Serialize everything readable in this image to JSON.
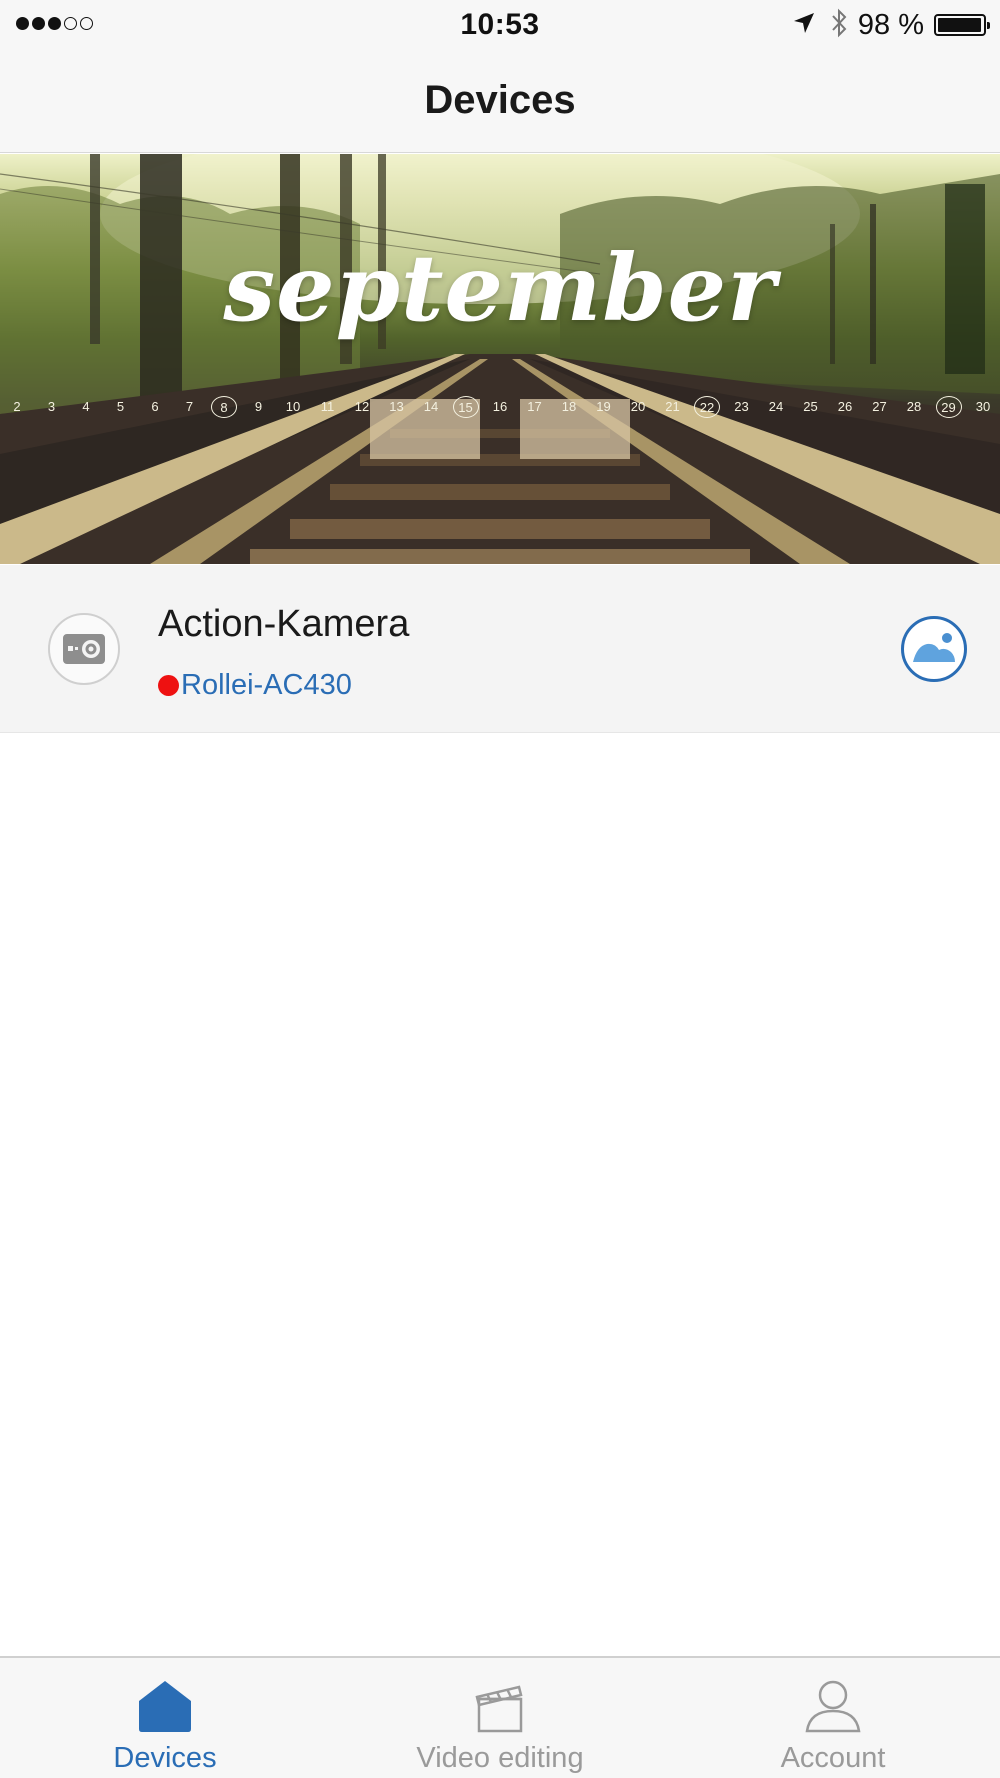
{
  "status_bar": {
    "signal_full_dots": 3,
    "signal_empty_dots": 2,
    "time": "10:53",
    "battery_percent_label": "98 %",
    "battery_level": 0.98,
    "icons": [
      "location-arrow-icon",
      "bluetooth-icon",
      "battery-icon"
    ]
  },
  "nav": {
    "title": "Devices"
  },
  "banner": {
    "word": "september",
    "days": [
      "2",
      "3",
      "4",
      "5",
      "6",
      "7",
      "8",
      "9",
      "10",
      "11",
      "12",
      "13",
      "14",
      "15",
      "16",
      "17",
      "18",
      "19",
      "20",
      "21",
      "22",
      "23",
      "24",
      "25",
      "26",
      "27",
      "28",
      "29",
      "30"
    ],
    "circled_days": [
      "8",
      "15",
      "22",
      "29"
    ]
  },
  "device": {
    "name": "Action-Kamera",
    "model": "Rollei-AC430",
    "status_color": "#ee1111",
    "icon": "camera-icon",
    "action_icon": "gallery-icon"
  },
  "tabs": [
    {
      "label": "Devices",
      "icon": "home-icon",
      "active": true
    },
    {
      "label": "Video editing",
      "icon": "clapperboard-icon",
      "active": false
    },
    {
      "label": "Account",
      "icon": "user-icon",
      "active": false
    }
  ],
  "colors": {
    "accent": "#2a6db5",
    "inactive": "#9a9a9a",
    "bar_background": "#f7f7f7"
  }
}
